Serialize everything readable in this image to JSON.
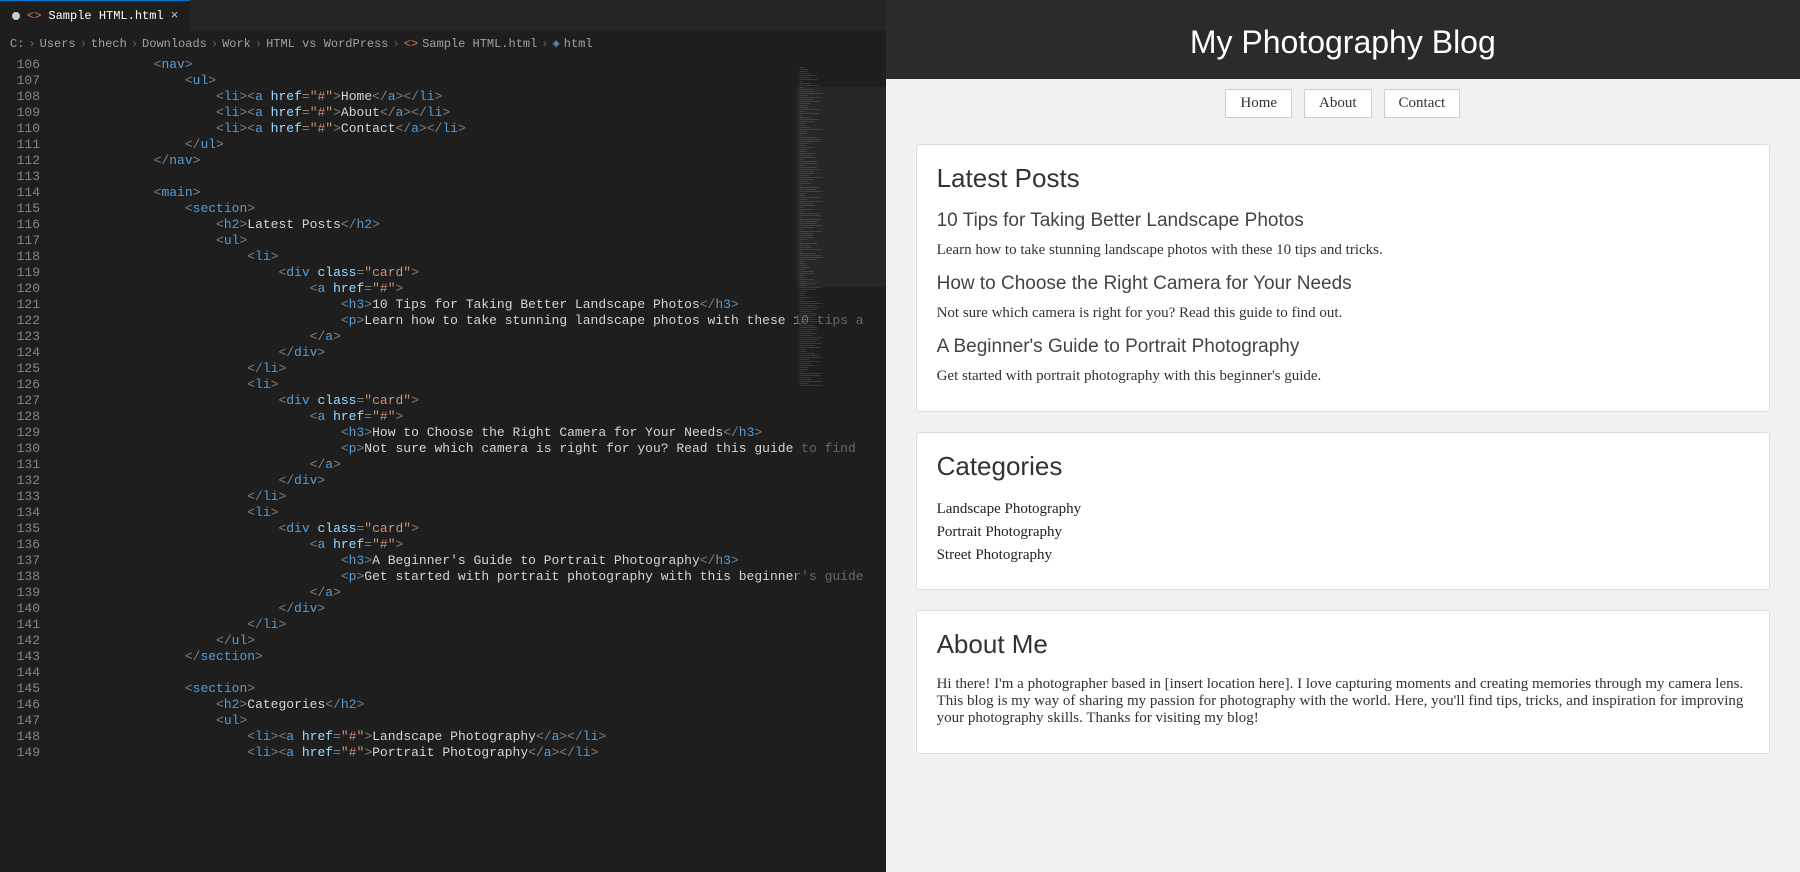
{
  "tab": {
    "filename": "Sample HTML.html"
  },
  "breadcrumbs": [
    "C:",
    "Users",
    "thech",
    "Downloads",
    "Work",
    "HTML vs WordPress",
    "Sample HTML.html",
    "html"
  ],
  "line_start": 106,
  "line_end": 149,
  "code_lines": [
    {
      "indent": 3,
      "tokens": [
        [
          "<",
          "br"
        ],
        [
          "nav",
          "t"
        ],
        [
          ">",
          "br"
        ]
      ]
    },
    {
      "indent": 4,
      "tokens": [
        [
          "<",
          "br"
        ],
        [
          "ul",
          "t"
        ],
        [
          ">",
          "br"
        ]
      ]
    },
    {
      "indent": 5,
      "tokens": [
        [
          "<",
          "br"
        ],
        [
          "li",
          "t"
        ],
        [
          "><",
          "br"
        ],
        [
          "a ",
          "t"
        ],
        [
          "href",
          "a"
        ],
        [
          "=",
          "br"
        ],
        [
          "\"#\"",
          "s"
        ],
        [
          ">",
          "br"
        ],
        [
          "Home",
          "tx"
        ],
        [
          "</",
          "br"
        ],
        [
          "a",
          "t"
        ],
        [
          "></",
          "br"
        ],
        [
          "li",
          "t"
        ],
        [
          ">",
          "br"
        ]
      ]
    },
    {
      "indent": 5,
      "tokens": [
        [
          "<",
          "br"
        ],
        [
          "li",
          "t"
        ],
        [
          "><",
          "br"
        ],
        [
          "a ",
          "t"
        ],
        [
          "href",
          "a"
        ],
        [
          "=",
          "br"
        ],
        [
          "\"#\"",
          "s"
        ],
        [
          ">",
          "br"
        ],
        [
          "About",
          "tx"
        ],
        [
          "</",
          "br"
        ],
        [
          "a",
          "t"
        ],
        [
          "></",
          "br"
        ],
        [
          "li",
          "t"
        ],
        [
          ">",
          "br"
        ]
      ]
    },
    {
      "indent": 5,
      "tokens": [
        [
          "<",
          "br"
        ],
        [
          "li",
          "t"
        ],
        [
          "><",
          "br"
        ],
        [
          "a ",
          "t"
        ],
        [
          "href",
          "a"
        ],
        [
          "=",
          "br"
        ],
        [
          "\"#\"",
          "s"
        ],
        [
          ">",
          "br"
        ],
        [
          "Contact",
          "tx"
        ],
        [
          "</",
          "br"
        ],
        [
          "a",
          "t"
        ],
        [
          "></",
          "br"
        ],
        [
          "li",
          "t"
        ],
        [
          ">",
          "br"
        ]
      ]
    },
    {
      "indent": 4,
      "tokens": [
        [
          "</",
          "br"
        ],
        [
          "ul",
          "t"
        ],
        [
          ">",
          "br"
        ]
      ]
    },
    {
      "indent": 3,
      "tokens": [
        [
          "</",
          "br"
        ],
        [
          "nav",
          "t"
        ],
        [
          ">",
          "br"
        ]
      ]
    },
    {
      "indent": 3,
      "tokens": []
    },
    {
      "indent": 3,
      "tokens": [
        [
          "<",
          "br"
        ],
        [
          "main",
          "t"
        ],
        [
          ">",
          "br"
        ]
      ]
    },
    {
      "indent": 4,
      "tokens": [
        [
          "<",
          "br"
        ],
        [
          "section",
          "t"
        ],
        [
          ">",
          "br"
        ]
      ]
    },
    {
      "indent": 5,
      "tokens": [
        [
          "<",
          "br"
        ],
        [
          "h2",
          "t"
        ],
        [
          ">",
          "br"
        ],
        [
          "Latest Posts",
          "tx"
        ],
        [
          "</",
          "br"
        ],
        [
          "h2",
          "t"
        ],
        [
          ">",
          "br"
        ]
      ]
    },
    {
      "indent": 5,
      "tokens": [
        [
          "<",
          "br"
        ],
        [
          "ul",
          "t"
        ],
        [
          ">",
          "br"
        ]
      ]
    },
    {
      "indent": 6,
      "tokens": [
        [
          "<",
          "br"
        ],
        [
          "li",
          "t"
        ],
        [
          ">",
          "br"
        ]
      ]
    },
    {
      "indent": 7,
      "tokens": [
        [
          "<",
          "br"
        ],
        [
          "div ",
          "t"
        ],
        [
          "class",
          "a"
        ],
        [
          "=",
          "br"
        ],
        [
          "\"card\"",
          "s"
        ],
        [
          ">",
          "br"
        ]
      ]
    },
    {
      "indent": 8,
      "tokens": [
        [
          "<",
          "br"
        ],
        [
          "a ",
          "t"
        ],
        [
          "href",
          "a"
        ],
        [
          "=",
          "br"
        ],
        [
          "\"#\"",
          "s"
        ],
        [
          ">",
          "br"
        ]
      ]
    },
    {
      "indent": 9,
      "tokens": [
        [
          "<",
          "br"
        ],
        [
          "h3",
          "t"
        ],
        [
          ">",
          "br"
        ],
        [
          "10 Tips for Taking Better Landscape Photos",
          "tx"
        ],
        [
          "</",
          "br"
        ],
        [
          "h3",
          "t"
        ],
        [
          ">",
          "br"
        ]
      ]
    },
    {
      "indent": 9,
      "tokens": [
        [
          "<",
          "br"
        ],
        [
          "p",
          "t"
        ],
        [
          ">",
          "br"
        ],
        [
          "Learn how to take stunning landscape photos with these 10 tips a",
          "tx"
        ]
      ]
    },
    {
      "indent": 8,
      "tokens": [
        [
          "</",
          "br"
        ],
        [
          "a",
          "t"
        ],
        [
          ">",
          "br"
        ]
      ]
    },
    {
      "indent": 7,
      "tokens": [
        [
          "</",
          "br"
        ],
        [
          "div",
          "t"
        ],
        [
          ">",
          "br"
        ]
      ]
    },
    {
      "indent": 6,
      "tokens": [
        [
          "</",
          "br"
        ],
        [
          "li",
          "t"
        ],
        [
          ">",
          "br"
        ]
      ]
    },
    {
      "indent": 6,
      "tokens": [
        [
          "<",
          "br"
        ],
        [
          "li",
          "t"
        ],
        [
          ">",
          "br"
        ]
      ]
    },
    {
      "indent": 7,
      "tokens": [
        [
          "<",
          "br"
        ],
        [
          "div ",
          "t"
        ],
        [
          "class",
          "a"
        ],
        [
          "=",
          "br"
        ],
        [
          "\"card\"",
          "s"
        ],
        [
          ">",
          "br"
        ]
      ]
    },
    {
      "indent": 8,
      "tokens": [
        [
          "<",
          "br"
        ],
        [
          "a ",
          "t"
        ],
        [
          "href",
          "a"
        ],
        [
          "=",
          "br"
        ],
        [
          "\"#\"",
          "s"
        ],
        [
          ">",
          "br"
        ]
      ]
    },
    {
      "indent": 9,
      "tokens": [
        [
          "<",
          "br"
        ],
        [
          "h3",
          "t"
        ],
        [
          ">",
          "br"
        ],
        [
          "How to Choose the Right Camera for Your Needs",
          "tx"
        ],
        [
          "</",
          "br"
        ],
        [
          "h3",
          "t"
        ],
        [
          ">",
          "br"
        ]
      ]
    },
    {
      "indent": 9,
      "tokens": [
        [
          "<",
          "br"
        ],
        [
          "p",
          "t"
        ],
        [
          ">",
          "br"
        ],
        [
          "Not sure which camera is right for you? Read this guide to find",
          "tx"
        ]
      ]
    },
    {
      "indent": 8,
      "tokens": [
        [
          "</",
          "br"
        ],
        [
          "a",
          "t"
        ],
        [
          ">",
          "br"
        ]
      ]
    },
    {
      "indent": 7,
      "tokens": [
        [
          "</",
          "br"
        ],
        [
          "div",
          "t"
        ],
        [
          ">",
          "br"
        ]
      ]
    },
    {
      "indent": 6,
      "tokens": [
        [
          "</",
          "br"
        ],
        [
          "li",
          "t"
        ],
        [
          ">",
          "br"
        ]
      ]
    },
    {
      "indent": 6,
      "tokens": [
        [
          "<",
          "br"
        ],
        [
          "li",
          "t"
        ],
        [
          ">",
          "br"
        ]
      ]
    },
    {
      "indent": 7,
      "tokens": [
        [
          "<",
          "br"
        ],
        [
          "div ",
          "t"
        ],
        [
          "class",
          "a"
        ],
        [
          "=",
          "br"
        ],
        [
          "\"card\"",
          "s"
        ],
        [
          ">",
          "br"
        ]
      ]
    },
    {
      "indent": 8,
      "tokens": [
        [
          "<",
          "br"
        ],
        [
          "a ",
          "t"
        ],
        [
          "href",
          "a"
        ],
        [
          "=",
          "br"
        ],
        [
          "\"#\"",
          "s"
        ],
        [
          ">",
          "br"
        ]
      ]
    },
    {
      "indent": 9,
      "tokens": [
        [
          "<",
          "br"
        ],
        [
          "h3",
          "t"
        ],
        [
          ">",
          "br"
        ],
        [
          "A Beginner's Guide to Portrait Photography",
          "tx"
        ],
        [
          "</",
          "br"
        ],
        [
          "h3",
          "t"
        ],
        [
          ">",
          "br"
        ]
      ]
    },
    {
      "indent": 9,
      "tokens": [
        [
          "<",
          "br"
        ],
        [
          "p",
          "t"
        ],
        [
          ">",
          "br"
        ],
        [
          "Get started with portrait photography with this beginner's guide",
          "tx"
        ]
      ]
    },
    {
      "indent": 8,
      "tokens": [
        [
          "</",
          "br"
        ],
        [
          "a",
          "t"
        ],
        [
          ">",
          "br"
        ]
      ]
    },
    {
      "indent": 7,
      "tokens": [
        [
          "</",
          "br"
        ],
        [
          "div",
          "t"
        ],
        [
          ">",
          "br"
        ]
      ]
    },
    {
      "indent": 6,
      "tokens": [
        [
          "</",
          "br"
        ],
        [
          "li",
          "t"
        ],
        [
          ">",
          "br"
        ]
      ]
    },
    {
      "indent": 5,
      "tokens": [
        [
          "</",
          "br"
        ],
        [
          "ul",
          "t"
        ],
        [
          ">",
          "br"
        ]
      ]
    },
    {
      "indent": 4,
      "tokens": [
        [
          "</",
          "br"
        ],
        [
          "section",
          "t"
        ],
        [
          ">",
          "br"
        ]
      ]
    },
    {
      "indent": 4,
      "tokens": []
    },
    {
      "indent": 4,
      "tokens": [
        [
          "<",
          "br"
        ],
        [
          "section",
          "t"
        ],
        [
          ">",
          "br"
        ]
      ]
    },
    {
      "indent": 5,
      "tokens": [
        [
          "<",
          "br"
        ],
        [
          "h2",
          "t"
        ],
        [
          ">",
          "br"
        ],
        [
          "Categories",
          "tx"
        ],
        [
          "</",
          "br"
        ],
        [
          "h2",
          "t"
        ],
        [
          ">",
          "br"
        ]
      ]
    },
    {
      "indent": 5,
      "tokens": [
        [
          "<",
          "br"
        ],
        [
          "ul",
          "t"
        ],
        [
          ">",
          "br"
        ]
      ]
    },
    {
      "indent": 6,
      "tokens": [
        [
          "<",
          "br"
        ],
        [
          "li",
          "t"
        ],
        [
          "><",
          "br"
        ],
        [
          "a ",
          "t"
        ],
        [
          "href",
          "a"
        ],
        [
          "=",
          "br"
        ],
        [
          "\"#\"",
          "s"
        ],
        [
          ">",
          "br"
        ],
        [
          "Landscape Photography",
          "tx"
        ],
        [
          "</",
          "br"
        ],
        [
          "a",
          "t"
        ],
        [
          "></",
          "br"
        ],
        [
          "li",
          "t"
        ],
        [
          ">",
          "br"
        ]
      ]
    },
    {
      "indent": 6,
      "tokens": [
        [
          "<",
          "br"
        ],
        [
          "li",
          "t"
        ],
        [
          "><",
          "br"
        ],
        [
          "a ",
          "t"
        ],
        [
          "href",
          "a"
        ],
        [
          "=",
          "br"
        ],
        [
          "\"#\"",
          "s"
        ],
        [
          ">",
          "br"
        ],
        [
          "Portrait Photography",
          "tx"
        ],
        [
          "</",
          "br"
        ],
        [
          "a",
          "t"
        ],
        [
          "></",
          "br"
        ],
        [
          "li",
          "t"
        ],
        [
          ">",
          "br"
        ]
      ]
    }
  ],
  "preview": {
    "title": "My Photography Blog",
    "nav": [
      "Home",
      "About",
      "Contact"
    ],
    "latest_heading": "Latest Posts",
    "posts": [
      {
        "title": "10 Tips for Taking Better Landscape Photos",
        "desc": "Learn how to take stunning landscape photos with these 10 tips and tricks."
      },
      {
        "title": "How to Choose the Right Camera for Your Needs",
        "desc": "Not sure which camera is right for you? Read this guide to find out."
      },
      {
        "title": "A Beginner's Guide to Portrait Photography",
        "desc": "Get started with portrait photography with this beginner's guide."
      }
    ],
    "categories_heading": "Categories",
    "categories": [
      "Landscape Photography",
      "Portrait Photography",
      "Street Photography"
    ],
    "about_heading": "About Me",
    "about_text": "Hi there! I'm a photographer based in [insert location here]. I love capturing moments and creating memories through my camera lens. This blog is my way of sharing my passion for photography with the world. Here, you'll find tips, tricks, and inspiration for improving your photography skills. Thanks for visiting my blog!"
  }
}
